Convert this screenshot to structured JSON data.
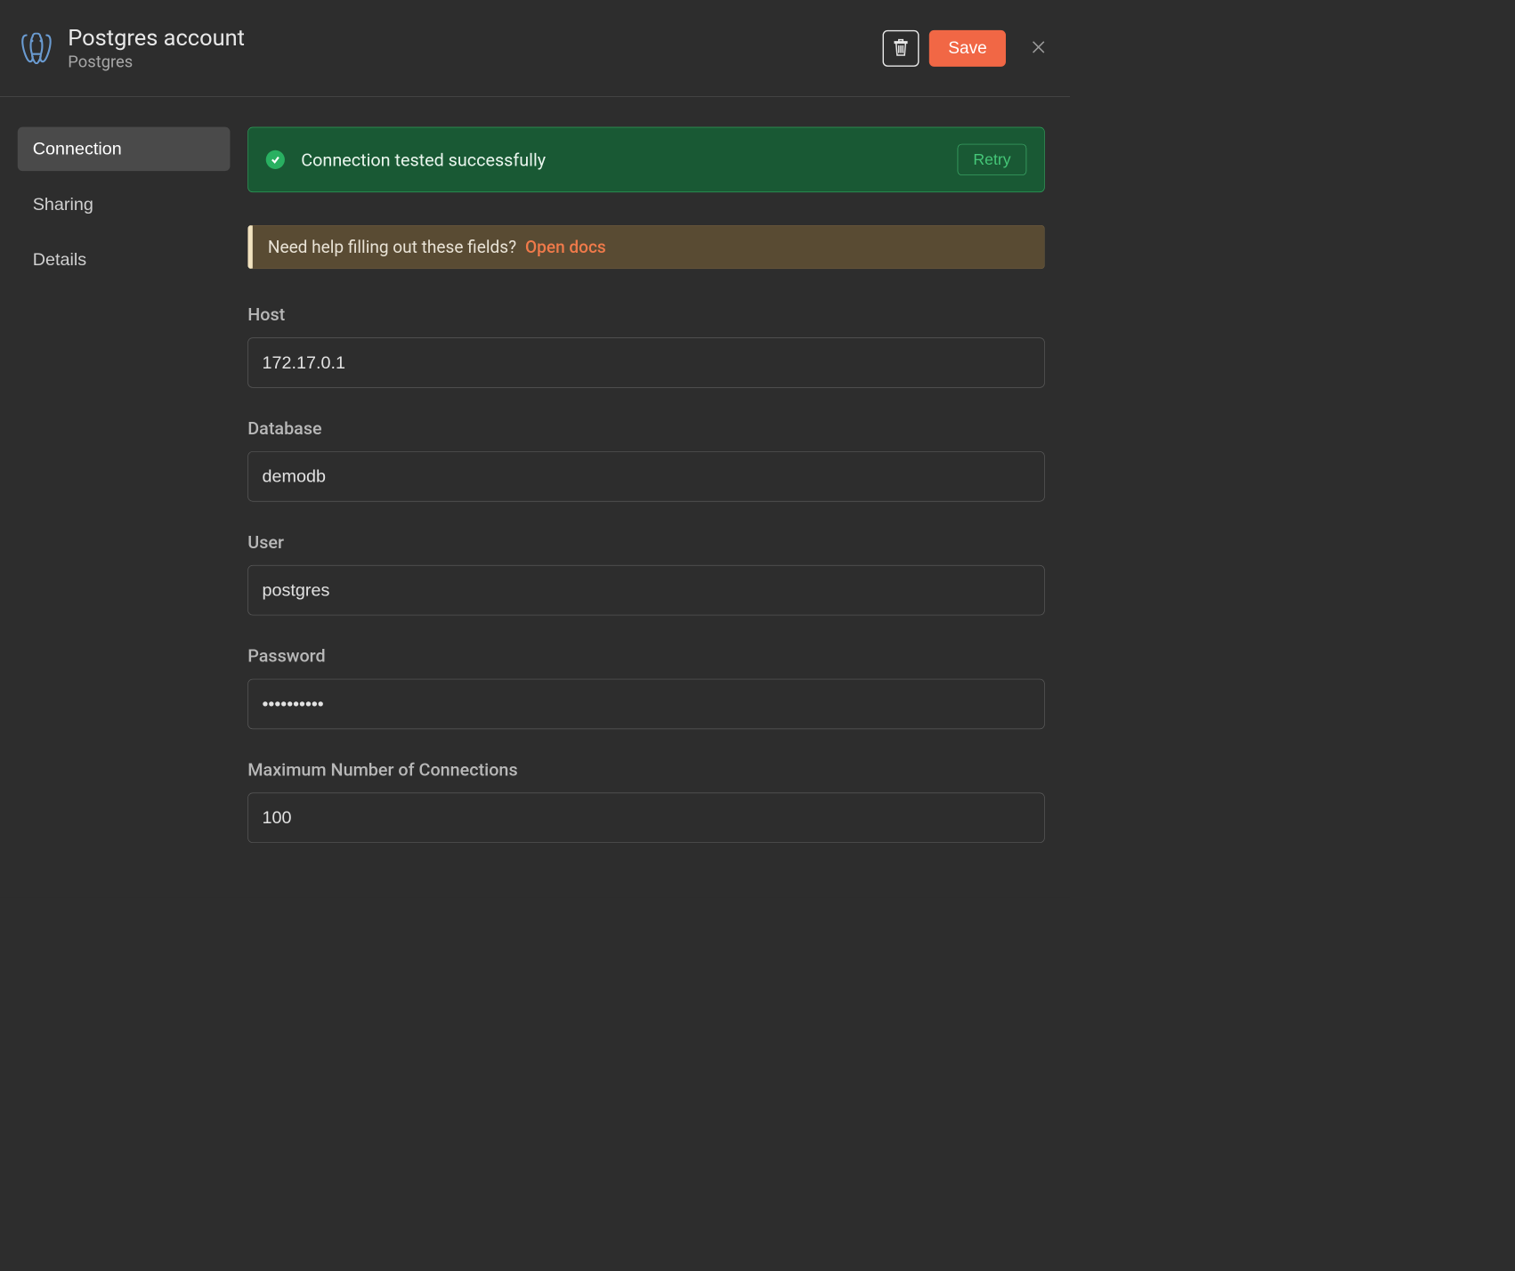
{
  "header": {
    "title": "Postgres account",
    "subtitle": "Postgres",
    "save_label": "Save"
  },
  "sidebar": {
    "items": [
      {
        "label": "Connection",
        "active": true
      },
      {
        "label": "Sharing",
        "active": false
      },
      {
        "label": "Details",
        "active": false
      }
    ]
  },
  "success_banner": {
    "text": "Connection tested successfully",
    "retry_label": "Retry"
  },
  "help_banner": {
    "text": "Need help filling out these fields?",
    "link_label": "Open docs"
  },
  "fields": {
    "host": {
      "label": "Host",
      "value": "172.17.0.1"
    },
    "database": {
      "label": "Database",
      "value": "demodb"
    },
    "user": {
      "label": "User",
      "value": "postgres"
    },
    "password": {
      "label": "Password",
      "value": "••••••••••"
    },
    "max_conn": {
      "label": "Maximum Number of Connections",
      "value": "100"
    }
  }
}
